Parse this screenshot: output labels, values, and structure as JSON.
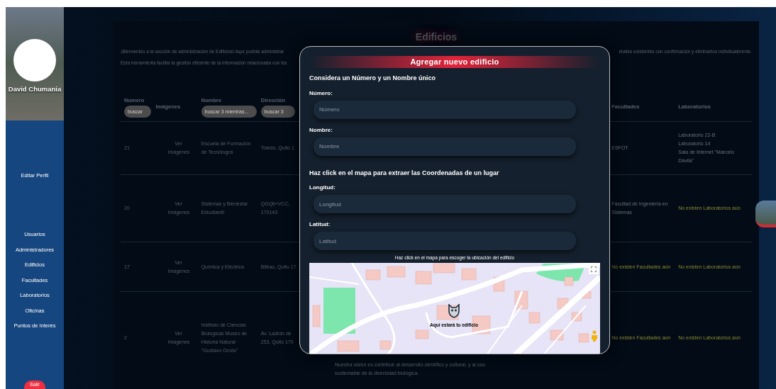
{
  "sidebar": {
    "user_name": "David Chumania",
    "profile_link": "Editar Perfil",
    "items": [
      "Usuarios",
      "Administradores",
      "Edificios",
      "Facultades",
      "Laboratorios",
      "Oficinas",
      "Puntos de Interés"
    ],
    "logout": "Salir"
  },
  "page": {
    "title": "Edificios",
    "intro_left": [
      "¡Bienvenido a la sección de administración de Edificios! Aquí podrás administrar",
      "Esta herramienta facilita la gestión eficiente de la información relacionada con los"
    ],
    "intro_right": "etalles existentes con confirmación y eliminarlos individualmente."
  },
  "table": {
    "columns": [
      {
        "label": "Número",
        "filter_placeholder": "buscar"
      },
      {
        "label": "Imágenes"
      },
      {
        "label": "Nombre",
        "filter_placeholder": "buscar 3 mientras..."
      },
      {
        "label": "Dirección",
        "filter_placeholder": "buscar 3"
      },
      {
        "label": "Facultades"
      },
      {
        "label": "Laboratorios"
      }
    ],
    "rows": [
      {
        "numero": "21",
        "imagenes": "Ver Imágenes",
        "nombre": "Escuela de Formación de Tecnólogos",
        "direccion": "Toledo, Quito 1",
        "facultades": {
          "text": "ESFOT",
          "empty": false
        },
        "laboratorios": {
          "items": [
            "Laboratorio 22-B",
            "Laboratorio 14",
            "Sala de Internet \"Marcelo Dávila\""
          ],
          "empty": false
        }
      },
      {
        "numero": "20",
        "imagenes": "Ver Imágenes",
        "nombre": "Sistemas y Bienestar Estudiantil",
        "direccion": "QGQ6+VCC,\n170143",
        "facultades": {
          "text": "Facultad de Ingeniería en Sistemas",
          "empty": false
        },
        "laboratorios": {
          "items": [
            "No existen Laboratorios aún"
          ],
          "empty": true
        }
      },
      {
        "numero": "17",
        "imagenes": "Ver Imágenes",
        "nombre": "Química y Eléctrica",
        "direccion": "Bilbao, Quito 17",
        "facultades": {
          "text": "No existen Facultades aún",
          "empty": true
        },
        "laboratorios": {
          "items": [
            "No existen Laboratorios aún"
          ],
          "empty": true
        }
      },
      {
        "numero": "2",
        "imagenes": "Ver Imágenes",
        "nombre": "Instituto de Ciencias Biológicas Museo de Historia Natural \"Gustavo Orcés\"",
        "direccion": "Av. Ladrón de\n253, Quito 170",
        "descripcion": "Nuestra visión es contribuir al desarrollo científico y cultural, y al uso sustentable de la diversidad biológica.",
        "facultades": {
          "text": "No existen Facultades aún",
          "empty": true
        },
        "laboratorios": {
          "items": [
            "No existen Laboratorios aún"
          ],
          "empty": true
        }
      }
    ]
  },
  "modal": {
    "title": "Agregar nuevo edificio",
    "section_1": "Considera un Número y un Nombre único",
    "fields": [
      {
        "label": "Número:",
        "placeholder": "Número"
      },
      {
        "label": "Nombre:",
        "placeholder": "Nombre"
      }
    ],
    "section_2": "Haz click en el mapa para extraer las Coordenadas de un lugar",
    "coord_fields": [
      {
        "label": "Longitud:",
        "placeholder": "Longitud"
      },
      {
        "label": "Latitud:",
        "placeholder": "Latitud"
      }
    ],
    "map_hint": "Haz click en el mapa para escoger la ubicación del edificio",
    "map": {
      "marker_label": "Aquí estará tu edificio"
    }
  }
}
